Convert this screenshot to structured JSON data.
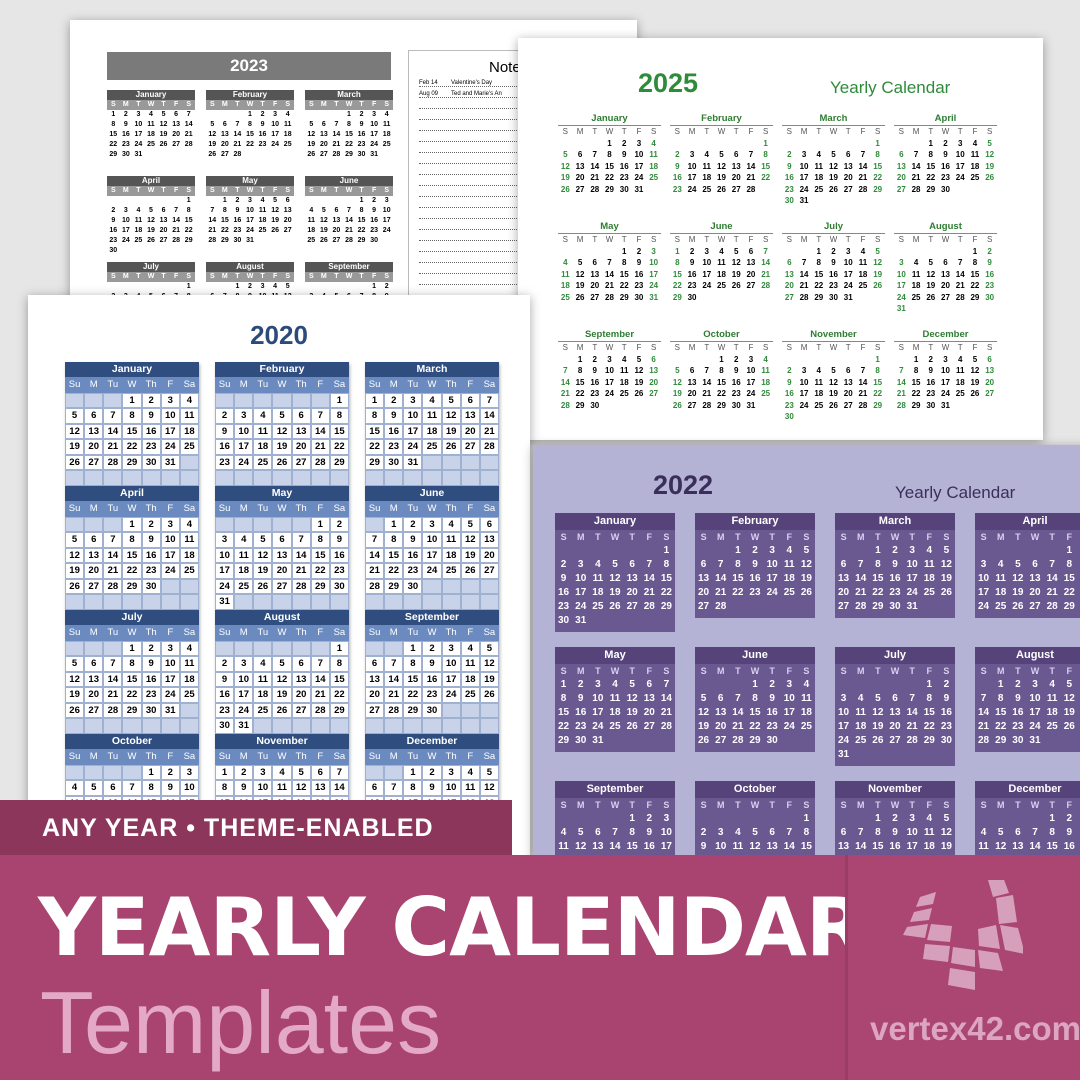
{
  "months": [
    "January",
    "February",
    "March",
    "April",
    "May",
    "June",
    "July",
    "August",
    "September",
    "October",
    "November",
    "December"
  ],
  "doc2023": {
    "year": "2023",
    "weekdays": [
      "S",
      "M",
      "T",
      "W",
      "T",
      "F",
      "S"
    ],
    "notes_title": "Notes",
    "notes": [
      {
        "date": "Feb 14",
        "text": "Valentine's Day"
      },
      {
        "date": "Aug 09",
        "text": "Ted and Marie's An"
      }
    ],
    "visible_months": 9
  },
  "doc2025": {
    "year": "2025",
    "subtitle": "Yearly Calendar",
    "weekdays": [
      "S",
      "M",
      "T",
      "W",
      "T",
      "F",
      "S"
    ],
    "color": "#2e8b3a"
  },
  "doc2020": {
    "year": "2020",
    "weekdays": [
      "Su",
      "M",
      "Tu",
      "W",
      "Th",
      "F",
      "Sa"
    ],
    "color": "#2f4d7e"
  },
  "doc2022": {
    "year": "2022",
    "subtitle": "Yearly Calendar",
    "weekdays": [
      "S",
      "M",
      "T",
      "W",
      "T",
      "F",
      "S"
    ],
    "color": "#6a5891"
  },
  "banner": {
    "tagline": "ANY YEAR • THEME-ENABLED",
    "title": "YEARLY CALENDAR",
    "subtitle": "Templates",
    "brand": "vertex42.com",
    "color": "#a8446f"
  }
}
